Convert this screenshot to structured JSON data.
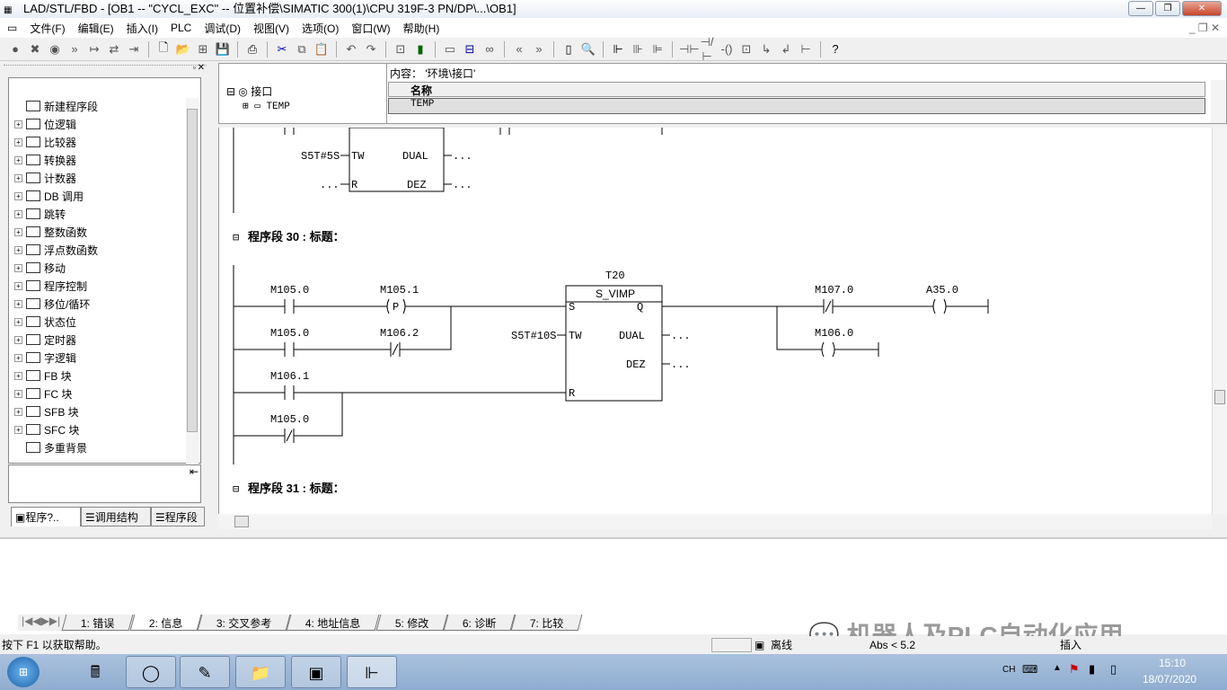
{
  "window": {
    "title": "LAD/STL/FBD  - [OB1 -- \"CYCL_EXC\" -- 位置补偿\\SIMATIC 300(1)\\CPU 319F-3 PN/DP\\...\\OB1]"
  },
  "menu": [
    "文件(F)",
    "编辑(E)",
    "插入(I)",
    "PLC",
    "调试(D)",
    "视图(V)",
    "选项(O)",
    "窗口(W)",
    "帮助(H)"
  ],
  "tree": [
    "新建程序段",
    "位逻辑",
    "比较器",
    "转换器",
    "计数器",
    "DB 调用",
    "跳转",
    "整数函数",
    "浮点数函数",
    "移动",
    "程序控制",
    "移位/循环",
    "状态位",
    "定时器",
    "字逻辑",
    "FB 块",
    "FC 块",
    "SFB 块",
    "SFC 块",
    "多重背景"
  ],
  "left_tabs": [
    "程序?..",
    "调用结构",
    "程序段"
  ],
  "interface": {
    "root": "接口",
    "child": "TEMP",
    "content_label": "内容： '环境\\接口'",
    "col_name": "名称",
    "row1": "TEMP"
  },
  "ladder": {
    "prev": {
      "tw": "S5T#5S",
      "tw_pin": "TW",
      "dual": "DUAL",
      "r_pin": "R",
      "dez": "DEZ",
      "dots": "..."
    },
    "net30": {
      "title": "程序段  30 : 标题：",
      "timer": "T20",
      "type": "S_VIMP",
      "s": "S",
      "q": "Q",
      "tw": "TW",
      "dual": "DUAL",
      "dez": "DEZ",
      "r": "R",
      "tw_val": "S5T#10S",
      "dots": "...",
      "c1": "M105.0",
      "c2": "M105.1",
      "c3": "M105.0",
      "c4": "M106.2",
      "c5": "M106.1",
      "c6": "M105.0",
      "c7": "M107.0",
      "coil1": "A35.0",
      "coil2": "M106.0",
      "p": "P"
    },
    "net31": {
      "title": "程序段  31 : 标题："
    }
  },
  "output_tabs": [
    "1: 错误",
    "2: 信息",
    "3: 交叉参考",
    "4: 地址信息",
    "5: 修改",
    "6: 诊断",
    "7: 比较"
  ],
  "status": {
    "help": "按下 F1 以获取帮助。",
    "mode": "离线",
    "abs": "Abs < 5.2",
    "insert": "插入"
  },
  "watermark": "机器人及PLC自动化应用",
  "taskbar": {
    "lang": "CH",
    "time": "15:10",
    "date": "18/07/2020"
  }
}
